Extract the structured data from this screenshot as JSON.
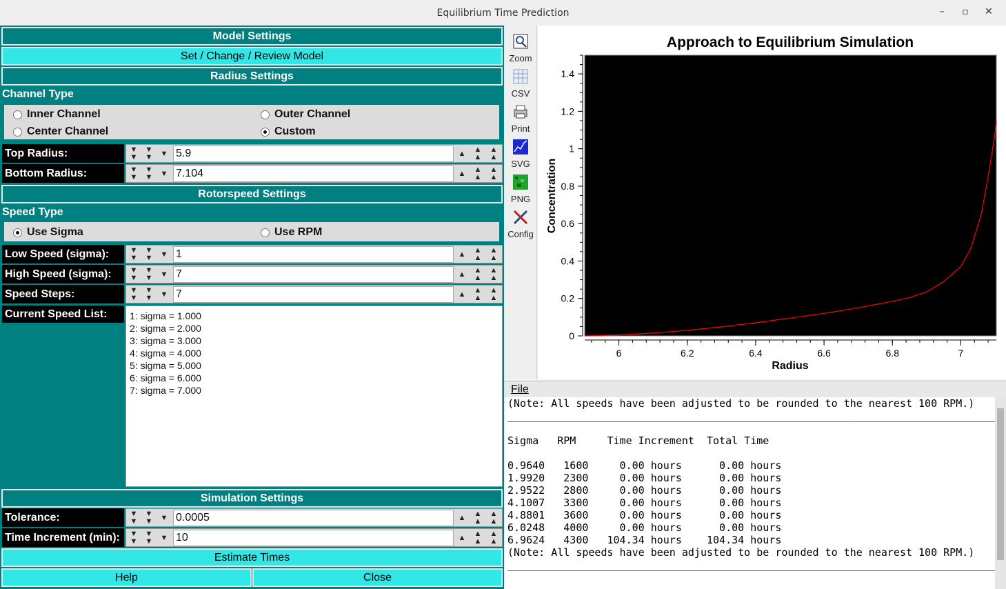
{
  "window": {
    "title": "Equilibrium Time Prediction",
    "minimize": "–",
    "maximize": "▫",
    "close": "✕"
  },
  "left": {
    "model_settings": "Model Settings",
    "set_model_button": "Set / Change / Review Model",
    "radius_settings": "Radius Settings",
    "channel_type_label": "Channel Type",
    "channels": [
      {
        "label": "Inner Channel",
        "selected": false
      },
      {
        "label": "Outer Channel",
        "selected": false
      },
      {
        "label": "Center Channel",
        "selected": false
      },
      {
        "label": "Custom",
        "selected": true
      }
    ],
    "top_radius": {
      "label": "Top Radius:",
      "value": "5.9"
    },
    "bottom_radius": {
      "label": "Bottom Radius:",
      "value": "7.104"
    },
    "rotorspeed_settings": "Rotorspeed Settings",
    "speed_type_label": "Speed Type",
    "speed_types": [
      {
        "label": "Use Sigma",
        "selected": true
      },
      {
        "label": "Use RPM",
        "selected": false
      }
    ],
    "low_speed": {
      "label": "Low Speed (sigma):",
      "value": "1"
    },
    "high_speed": {
      "label": "High Speed (sigma):",
      "value": "7"
    },
    "speed_steps": {
      "label": "Speed Steps:",
      "value": "7"
    },
    "current_speed_list_label": "Current Speed List:",
    "speed_list": [
      "1: sigma = 1.000",
      "2: sigma = 2.000",
      "3: sigma = 3.000",
      "4: sigma = 4.000",
      "5: sigma = 5.000",
      "6: sigma = 6.000",
      "7: sigma = 7.000"
    ],
    "simulation_settings": "Simulation Settings",
    "tolerance": {
      "label": "Tolerance:",
      "value": "0.0005"
    },
    "time_increment": {
      "label": "Time Increment (min):",
      "value": "10"
    },
    "estimate_button": "Estimate Times",
    "help_button": "Help",
    "close_button": "Close"
  },
  "toolbar": [
    {
      "label": "Zoom",
      "icon": "zoom-icon"
    },
    {
      "label": "CSV",
      "icon": "csv-icon"
    },
    {
      "label": "Print",
      "icon": "print-icon"
    },
    {
      "label": "SVG",
      "icon": "svg-icon"
    },
    {
      "label": "PNG",
      "icon": "png-icon"
    },
    {
      "label": "Config",
      "icon": "config-icon"
    }
  ],
  "chart_data": {
    "type": "line",
    "title": "Approach to Equilibrium Simulation",
    "xlabel": "Radius",
    "ylabel": "Concentration",
    "xlim": [
      5.9,
      7.104
    ],
    "ylim": [
      0,
      1.5
    ],
    "xticks": [
      "6",
      "6.2",
      "6.4",
      "6.6",
      "6.8",
      "7"
    ],
    "yticks": [
      "0",
      "0.2",
      "0.4",
      "0.6",
      "0.8",
      "1",
      "1.2",
      "1.4"
    ],
    "background": "#000000",
    "series": [
      {
        "color": "#ff0000",
        "x": [
          5.9,
          6.0,
          6.1,
          6.2,
          6.3,
          6.4,
          6.5,
          6.6,
          6.7,
          6.8,
          6.85,
          6.9,
          6.95,
          7.0,
          7.03,
          7.06,
          7.08,
          7.1,
          7.104
        ],
        "y": [
          0.0,
          0.005,
          0.015,
          0.03,
          0.048,
          0.07,
          0.095,
          0.12,
          0.15,
          0.185,
          0.205,
          0.235,
          0.29,
          0.37,
          0.47,
          0.65,
          0.85,
          1.08,
          1.15
        ]
      }
    ]
  },
  "log": {
    "menu_file": "File",
    "lines": [
      "(Note: All speeds have been adjusted to be rounded to the nearest 100 RPM.)",
      "_________________________________________________________________________________",
      "",
      "Sigma   RPM     Time Increment  Total Time",
      "",
      "0.9640   1600     0.00 hours      0.00 hours",
      "1.9920   2300     0.00 hours      0.00 hours",
      "2.9522   2800     0.00 hours      0.00 hours",
      "4.1007   3300     0.00 hours      0.00 hours",
      "4.8801   3600     0.00 hours      0.00 hours",
      "6.0248   4000     0.00 hours      0.00 hours",
      "6.9624   4300   104.34 hours    104.34 hours",
      "(Note: All speeds have been adjusted to be rounded to the nearest 100 RPM.)",
      "_________________________________________________________________________________"
    ]
  }
}
